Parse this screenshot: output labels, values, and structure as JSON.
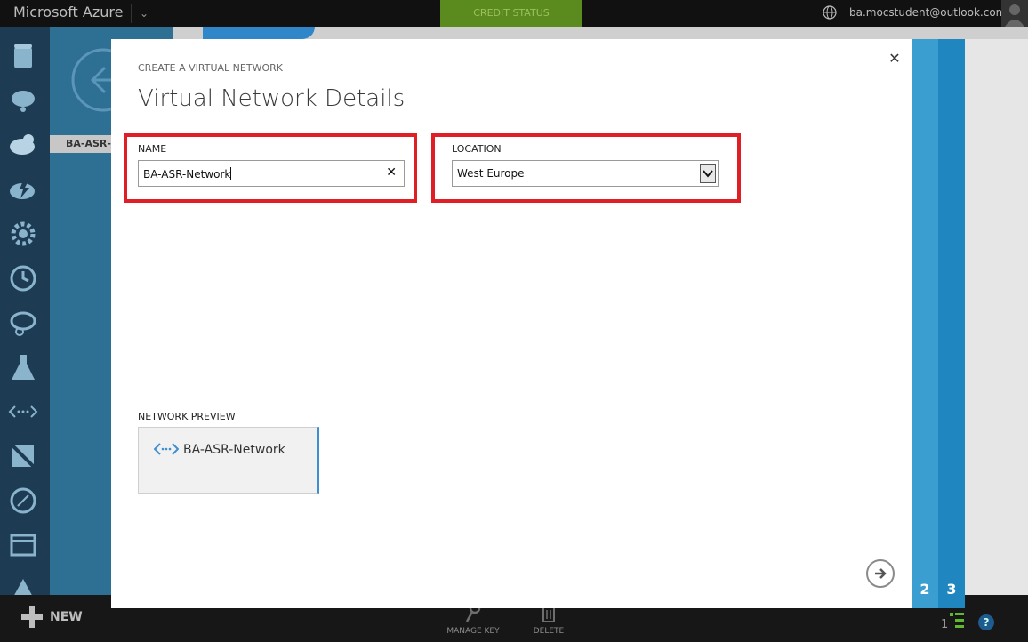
{
  "topbar": {
    "brand": "Microsoft Azure",
    "credit_status": "CREDIT STATUS",
    "user_email": "ba.mocstudent@outlook.com"
  },
  "leftpanel": {
    "item_text": "BA-ASR-R"
  },
  "modal": {
    "kicker": "CREATE A VIRTUAL NETWORK",
    "title": "Virtual Network Details",
    "name_label": "NAME",
    "name_value": "BA-ASR-Network",
    "location_label": "LOCATION",
    "location_value": "West Europe",
    "preview_label": "NETWORK PREVIEW",
    "preview_name": "BA-ASR-Network",
    "steps": [
      "2",
      "3"
    ]
  },
  "bottombar": {
    "new_label": "NEW",
    "manage_key": "MANAGE KEY",
    "delete": "DELETE",
    "count": "1",
    "help": "?"
  },
  "colors": {
    "accent_blue": "#3a9fd0",
    "step_blue": "#1f86bf",
    "highlight_red": "#e01e26",
    "credit_green": "#5b8a1e"
  }
}
